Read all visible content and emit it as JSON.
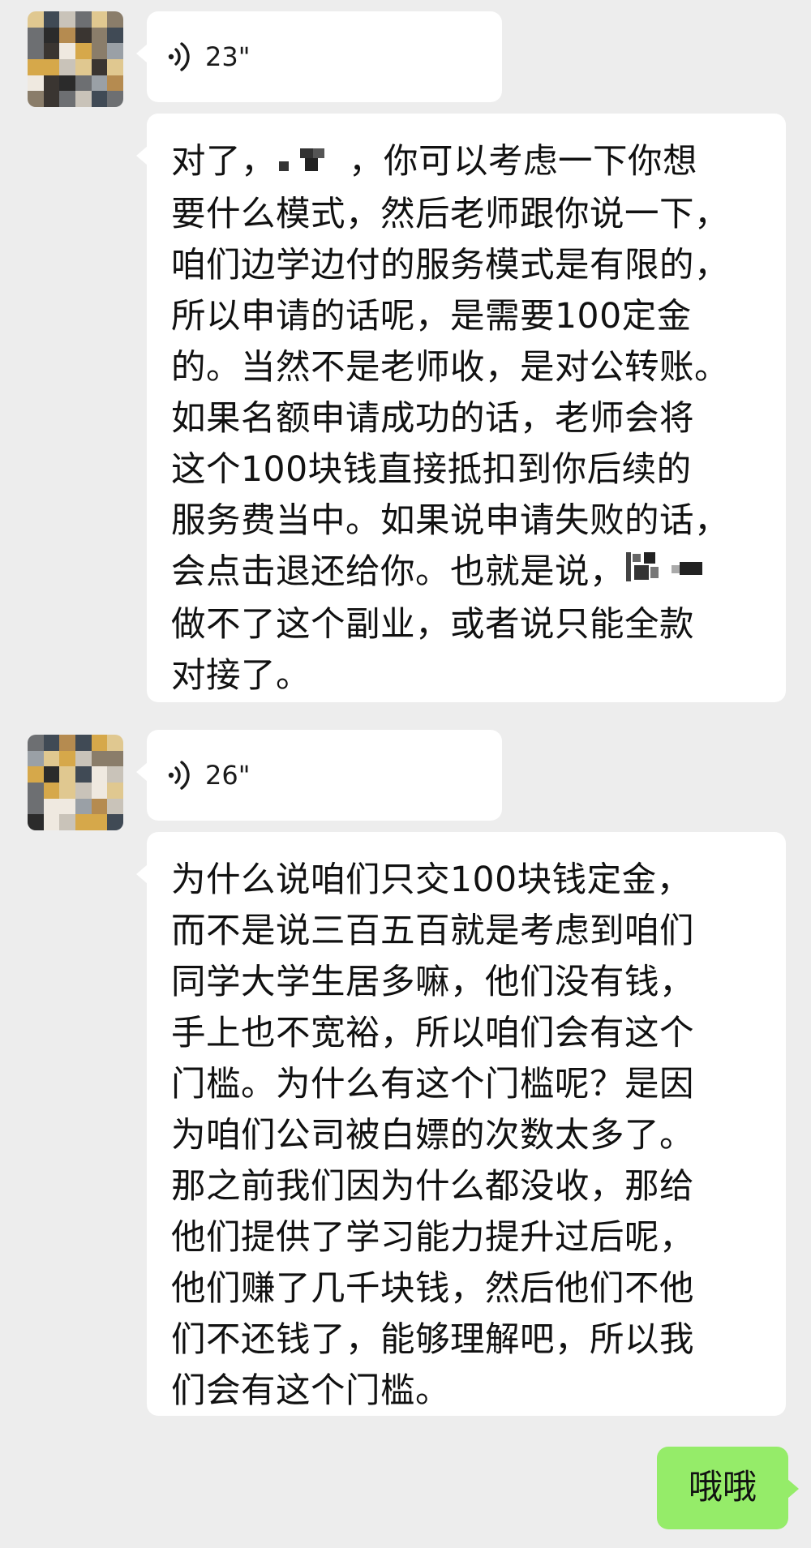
{
  "messages": [
    {
      "type": "voice",
      "from": "other",
      "duration": "23\""
    },
    {
      "type": "text",
      "from": "other",
      "lines": [
        "对了，",
        "，你可以考虑一下你想",
        "要什么模式，然后老师跟你说一下，",
        "咱们边学边付的服务模式是有限的，",
        "所以申请的话呢，是需要100定金",
        "的。当然不是老师收，是对公转账。",
        "如果名额申请成功的话，老师会将",
        "这个100块钱直接抵扣到你后续的",
        "服务费当中。如果说申请失败的话，",
        "会点击退还给你。也就是说，",
        "做不了这个副业，或者说只能全款",
        "对接了。"
      ]
    },
    {
      "type": "voice",
      "from": "other",
      "duration": "26\""
    },
    {
      "type": "text",
      "from": "other",
      "lines": [
        "为什么说咱们只交100块钱定金，",
        "而不是说三百五百就是考虑到咱们",
        "同学大学生居多嘛，他们没有钱，",
        "手上也不宽裕，所以咱们会有这个",
        "门槛。为什么有这个门槛呢？是因",
        "为咱们公司被白嫖的次数太多了。",
        "那之前我们因为什么都没收，那给",
        "他们提供了学习能力提升过后呢，",
        "他们赚了几千块钱，然后他们不他",
        "们不还钱了，能够理解吧，所以我",
        "们会有这个门槛。"
      ]
    },
    {
      "type": "text",
      "from": "me",
      "text": "哦哦"
    }
  ],
  "colors": {
    "background": "#ededed",
    "incoming_bubble": "#ffffff",
    "outgoing_bubble": "#95ec69"
  },
  "icons": {
    "voice": "voice-wave-icon",
    "avatar": "pixelated-avatar"
  }
}
